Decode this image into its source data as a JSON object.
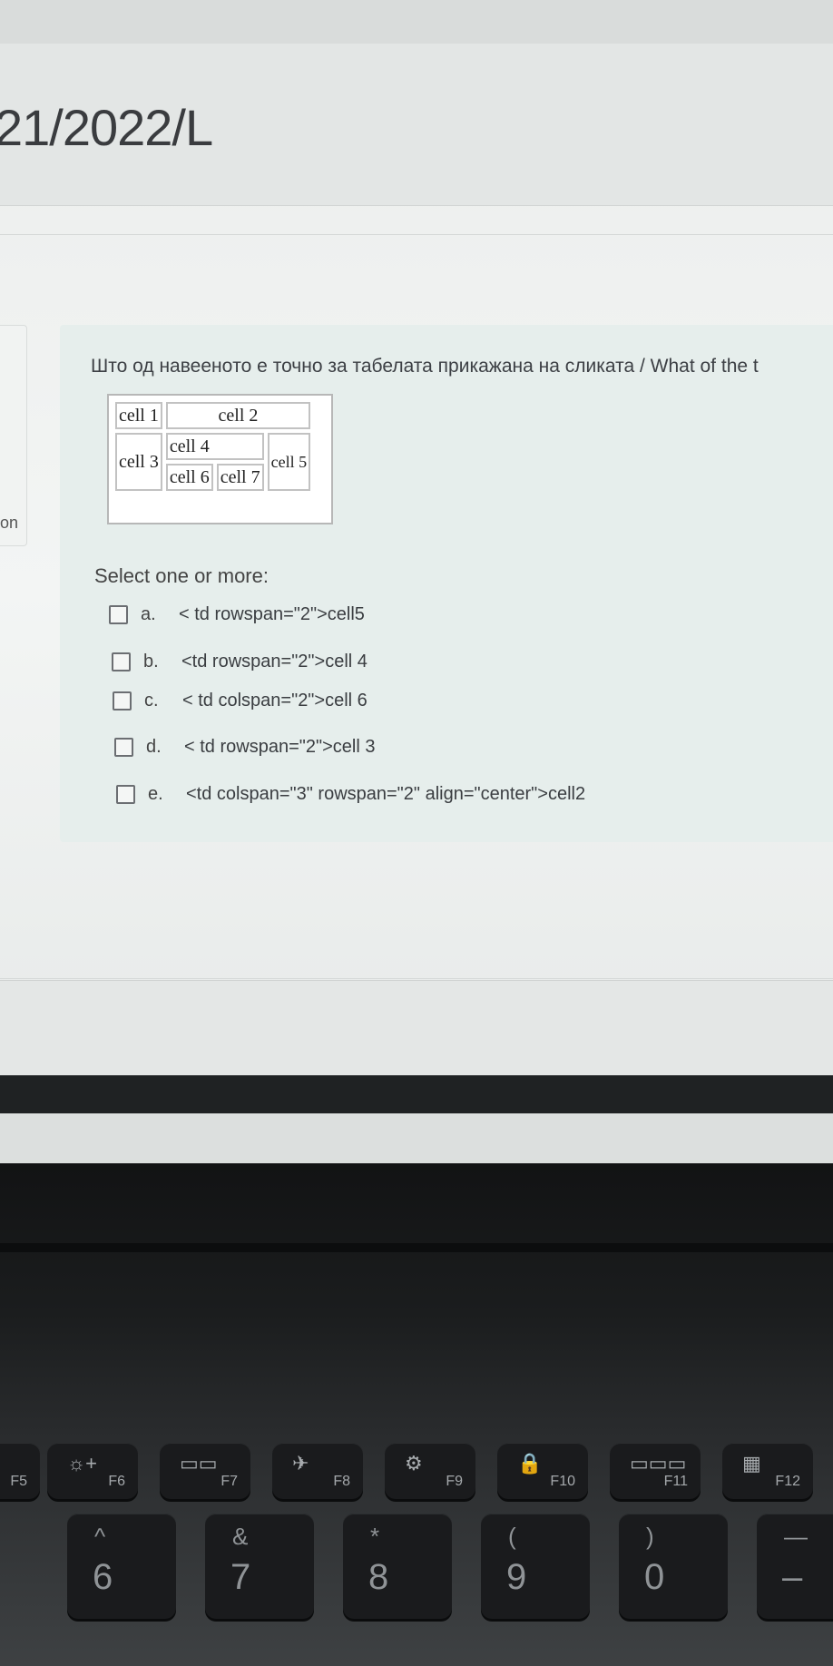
{
  "page_title": "21/2022/L",
  "left_label": "on",
  "question": {
    "text": "Што од навеенoто е точно за табелата прикажана на сликата / What of the t",
    "table_cells": {
      "cell1": "cell 1",
      "cell2": "cell 2",
      "cell3": "cell 3",
      "cell4": "cell 4",
      "cell5": "cell 5",
      "cell6": "cell 6",
      "cell7": "cell 7"
    },
    "select_label": "Select one or more:",
    "options": [
      {
        "letter": "a.",
        "text": "< td rowspan=\"2\">cell5"
      },
      {
        "letter": "b.",
        "text": "<td rowspan=\"2\">cell 4"
      },
      {
        "letter": "c.",
        "text": "< td colspan=\"2\">cell 6"
      },
      {
        "letter": "d.",
        "text": "< td rowspan=\"2\">cell 3"
      },
      {
        "letter": "e.",
        "text": "<td colspan=\"3\" rowspan=\"2\" align=\"center\">cell2"
      }
    ]
  },
  "keyboard": {
    "fkeys": [
      {
        "label": "F5",
        "icon": ""
      },
      {
        "label": "F6",
        "icon": "☼+"
      },
      {
        "label": "F7",
        "icon": "▭▭"
      },
      {
        "label": "F8",
        "icon": "✈"
      },
      {
        "label": "F9",
        "icon": "⚙"
      },
      {
        "label": "F10",
        "icon": "🔒"
      },
      {
        "label": "F11",
        "icon": "▭▭▭"
      },
      {
        "label": "F12",
        "icon": "▦"
      }
    ],
    "numkeys": [
      {
        "top": "^",
        "bottom": "6"
      },
      {
        "top": "&",
        "bottom": "7"
      },
      {
        "top": "*",
        "bottom": "8"
      },
      {
        "top": "(",
        "bottom": "9"
      },
      {
        "top": ")",
        "bottom": "0"
      },
      {
        "top": "—",
        "bottom": "–"
      }
    ]
  }
}
